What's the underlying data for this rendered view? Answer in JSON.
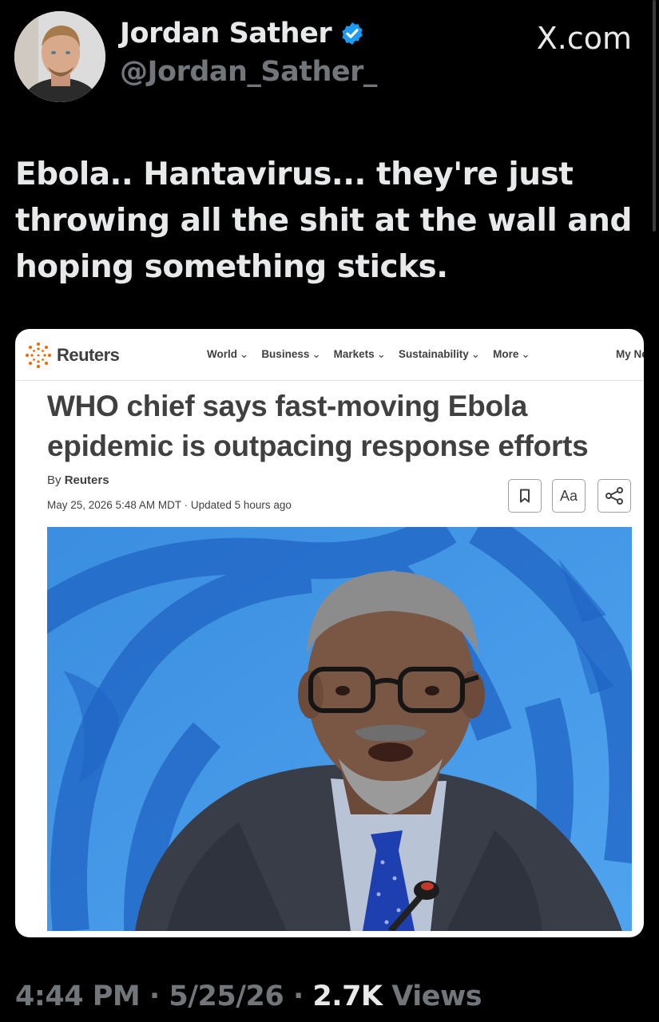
{
  "author": {
    "name": "Jordan Sather",
    "handle": "@Jordan_Sather_",
    "verified": true,
    "verified_color": "#1d9bf0"
  },
  "brand": {
    "site": "X.com"
  },
  "tweet": {
    "text": "Ebola.. Hantavirus... they're just throwing all the shit at the wall and hoping something sticks."
  },
  "article": {
    "logo_text": "Reuters",
    "logo_color": "#fa6400",
    "nav": [
      {
        "label": "World"
      },
      {
        "label": "Business"
      },
      {
        "label": "Markets"
      },
      {
        "label": "Sustainability"
      },
      {
        "label": "More"
      }
    ],
    "nav_overflow": "My Ne",
    "headline": "WHO chief says fast-moving Ebola epidemic is outpacing response efforts",
    "byline_prefix": "By",
    "byline_author": "Reuters",
    "dateline": "May 25, 2026 5:48 AM MDT · Updated 5 hours ago",
    "tools": {
      "bookmark_icon": "bookmark-icon",
      "font_size_label": "Aa",
      "share_icon": "share-icon"
    },
    "image_colors": {
      "backdrop": "#3b8ee0",
      "emblem": "#1f64c4",
      "suit": "#383d48",
      "tie": "#1d3fb0"
    }
  },
  "meta": {
    "time": "4:44 PM",
    "separator": "·",
    "date": "5/25/26",
    "views_count": "2.7K",
    "views_label": "Views"
  }
}
